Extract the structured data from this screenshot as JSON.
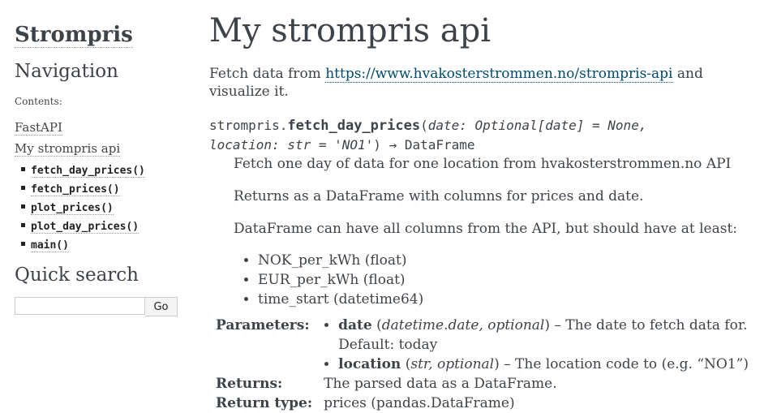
{
  "sidebar": {
    "logo": "Strompris",
    "navigation_heading": "Navigation",
    "contents_caption": "Contents:",
    "toc": [
      {
        "label": "FastAPI"
      },
      {
        "label": "My strompris api"
      }
    ],
    "subitems": [
      {
        "label": "fetch_day_prices()"
      },
      {
        "label": "fetch_prices()"
      },
      {
        "label": "plot_prices()"
      },
      {
        "label": "plot_day_prices()"
      },
      {
        "label": "main()"
      }
    ],
    "quick_search_heading": "Quick search",
    "search_value": "",
    "search_button": "Go"
  },
  "main": {
    "title": "My strompris api",
    "intro_prefix": "Fetch data from ",
    "intro_link": "https://www.hvakosterstrommen.no/strompris-api",
    "intro_suffix": " and visualize it.",
    "signature": {
      "module": "strompris.",
      "name": "fetch_day_prices",
      "open_paren": "(",
      "param1": "date: Optional[date] = None,",
      "param2": "location: str = 'NO1'",
      "close": ") → DataFrame"
    },
    "desc1": "Fetch one day of data for one location from hvakosterstrommen.no API",
    "desc2": "Returns as a DataFrame with columns for prices and date.",
    "desc3": "DataFrame can have all columns from the API, but should have at least:",
    "columns": [
      "NOK_per_kWh (float)",
      "EUR_per_kWh (float)",
      "time_start (datetime64)"
    ],
    "fields": {
      "parameters_label": "Parameters:",
      "params": [
        {
          "name": "date",
          "type": "datetime.date, optional",
          "desc": " – The date to fetch data for. Default: today"
        },
        {
          "name": "location",
          "type": "str, optional",
          "desc": " – The location code to (e.g. “NO1”)"
        }
      ],
      "returns_label": "Returns:",
      "returns": "The parsed data as a DataFrame.",
      "return_type_label": "Return type:",
      "return_type": "prices (pandas.DataFrame)"
    }
  }
}
